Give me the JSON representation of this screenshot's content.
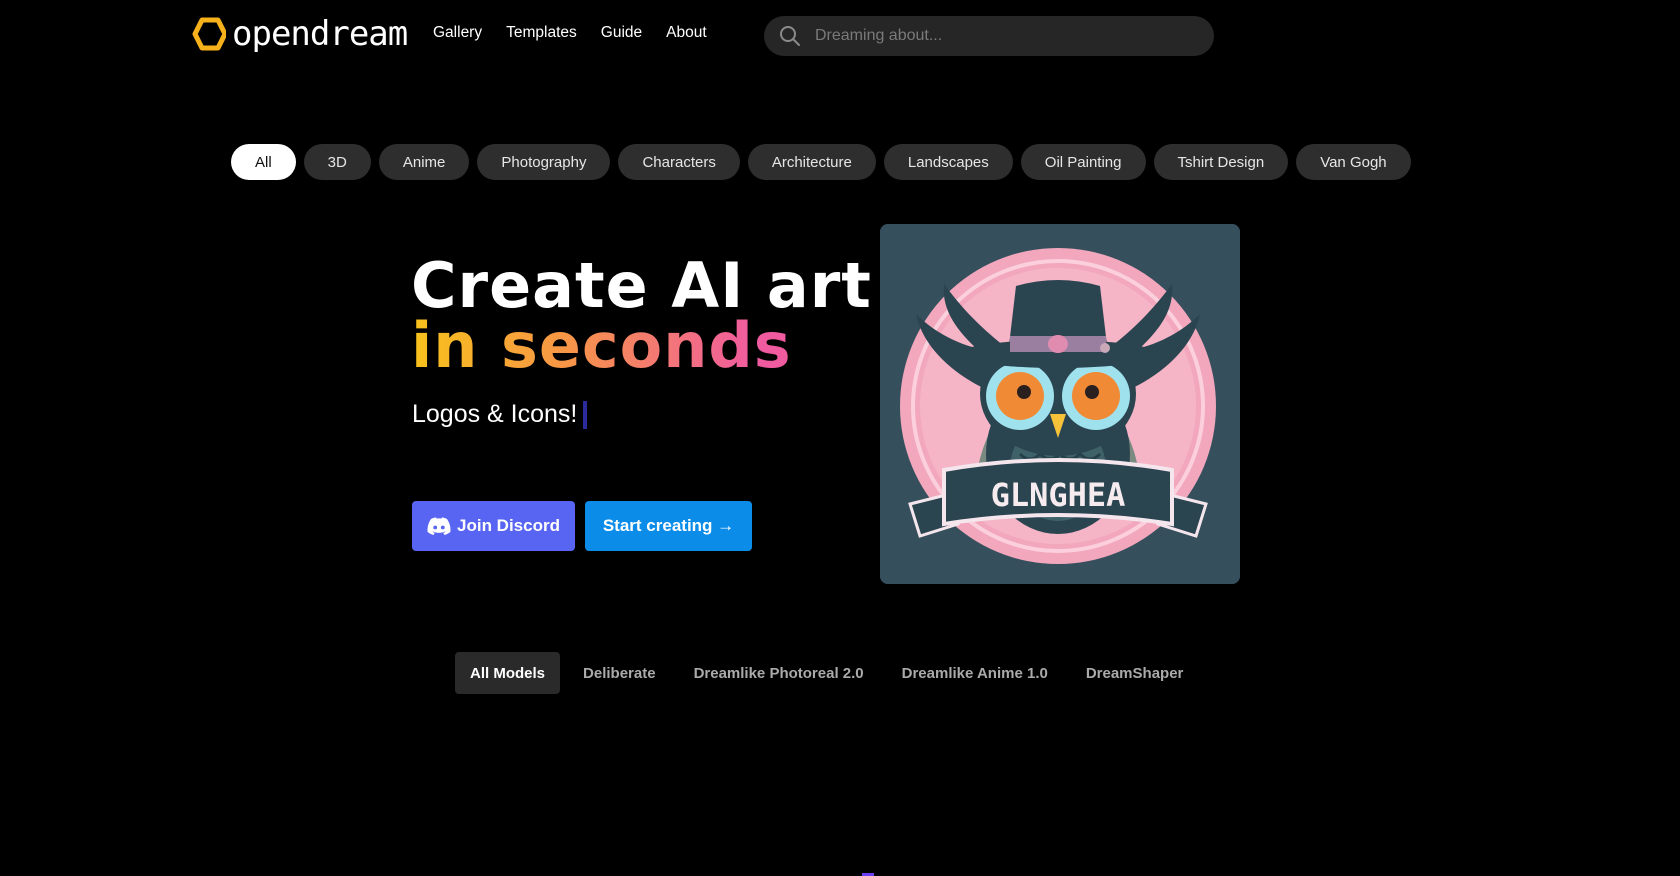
{
  "header": {
    "logo_text": "opendream",
    "nav": [
      "Gallery",
      "Templates",
      "Guide",
      "About"
    ],
    "search_placeholder": "Dreaming about..."
  },
  "categories": [
    "All",
    "3D",
    "Anime",
    "Photography",
    "Characters",
    "Architecture",
    "Landscapes",
    "Oil Painting",
    "Tshirt Design",
    "Van Gogh"
  ],
  "active_category": "All",
  "hero": {
    "title_line1": "Create AI art",
    "title_line2": "in seconds",
    "subtitle": "Logos & Icons!",
    "discord_button": "Join Discord",
    "start_button": "Start creating →",
    "image_banner_text": "GLNGHEA"
  },
  "models": {
    "tabs": [
      "All Models",
      "Deliberate",
      "Dreamlike Photoreal 2.0",
      "Dreamlike Anime 1.0",
      "DreamShaper"
    ],
    "active": "All Models"
  },
  "colors": {
    "background": "#000000",
    "pill": "#2e2e2e",
    "discord": "#5865f2",
    "start": "#0c8ce9",
    "gradient": [
      "#f7c21b",
      "#f79646",
      "#f05ba0"
    ]
  }
}
